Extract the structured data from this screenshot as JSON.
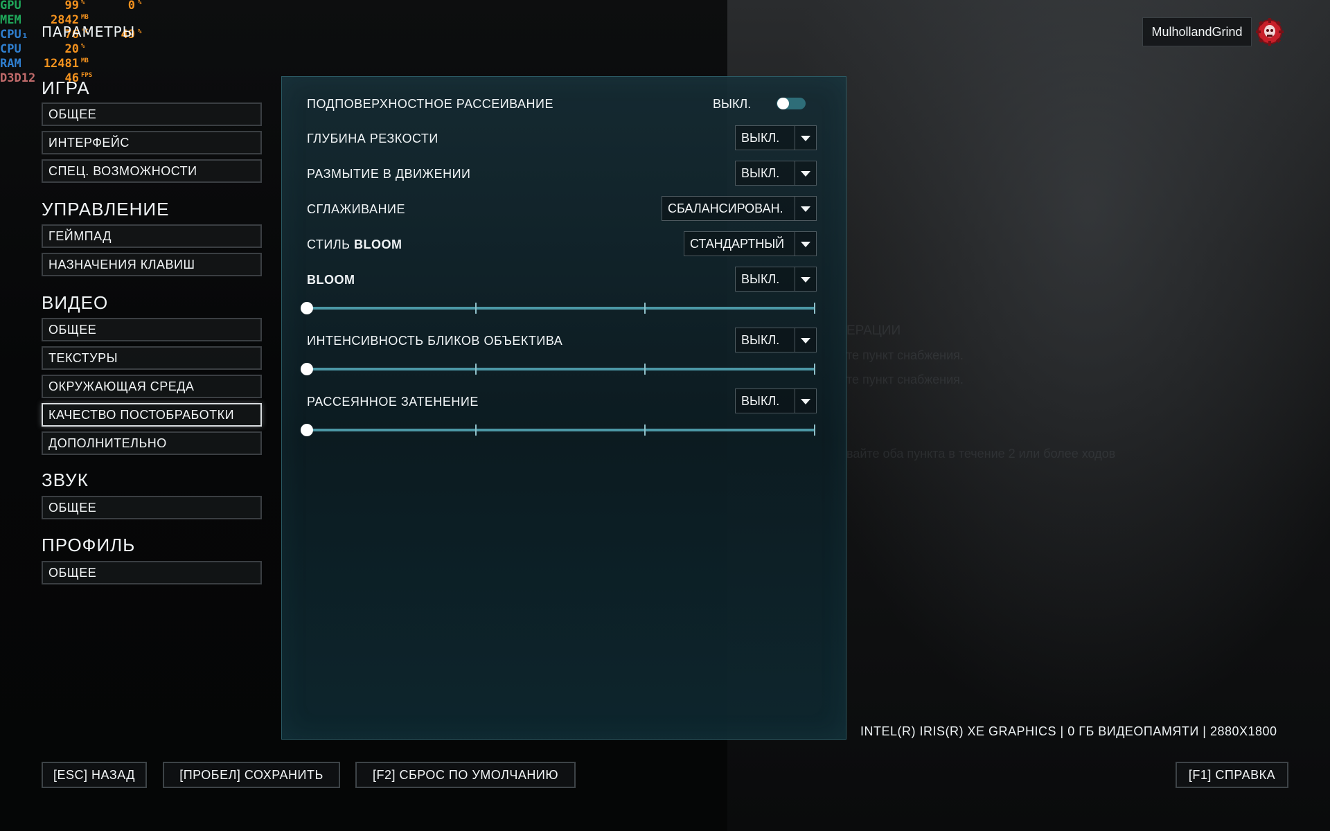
{
  "osd": {
    "rows": [
      {
        "label": "GPU",
        "label_color": "#1fa85a",
        "v1": "99",
        "u1": "%",
        "v2": "0",
        "u2": "%"
      },
      {
        "label": "MEM",
        "label_color": "#1fa85a",
        "v1": "2842",
        "u1": "MB",
        "v2": "",
        "u2": ""
      },
      {
        "label": "CPU₁",
        "label_color": "#2f7fd0",
        "v1": "76",
        "u1": "°C",
        "v2": "49",
        "u2": "%"
      },
      {
        "label": "CPU",
        "label_color": "#2f7fd0",
        "v1": "20",
        "u1": "%",
        "v2": "",
        "u2": ""
      },
      {
        "label": "RAM",
        "label_color": "#2f7fd0",
        "v1": "12481",
        "u1": "MB",
        "v2": "",
        "u2": ""
      },
      {
        "label": "D3D12",
        "label_color": "#c06a6a",
        "v1": "46",
        "u1": "FPS",
        "v2": "",
        "u2": ""
      }
    ]
  },
  "page_title": "ПАРАМЕТРЫ",
  "user": {
    "name": "MulhollandGrind",
    "avatar_icon": "gears-cog-skull-icon",
    "avatar_color": "#c8202a"
  },
  "sidebar": {
    "sections": [
      {
        "title": "ИГРА",
        "items": [
          "ОБЩЕЕ",
          "ИНТЕРФЕЙС",
          "СПЕЦ. ВОЗМОЖНОСТИ"
        ]
      },
      {
        "title": "УПРАВЛЕНИЕ",
        "items": [
          "ГЕЙМПАД",
          "НАЗНАЧЕНИЯ КЛАВИШ"
        ]
      },
      {
        "title": "ВИДЕО",
        "items": [
          "ОБЩЕЕ",
          "ТЕКСТУРЫ",
          "ОКРУЖАЮЩАЯ СРЕДА",
          "КАЧЕСТВО ПОСТОБРАБОТКИ",
          "ДОПОЛНИТЕЛЬНО"
        ]
      },
      {
        "title": "ЗВУК",
        "items": [
          "ОБЩЕЕ"
        ]
      },
      {
        "title": "ПРОФИЛЬ",
        "items": [
          "ОБЩЕЕ"
        ]
      }
    ],
    "active": "КАЧЕСТВО ПОСТОБРАБОТКИ"
  },
  "settings": {
    "subsurface": {
      "label": "ПОДПОВЕРХНОСТНОЕ РАССЕИВАНИЕ",
      "state_text": "ВЫКЛ.",
      "on": false
    },
    "dof": {
      "label": "ГЛУБИНА РЕЗКОСТИ",
      "value": "ВЫКЛ."
    },
    "motion_blur": {
      "label": "РАЗМЫТИЕ В ДВИЖЕНИИ",
      "value": "ВЫКЛ."
    },
    "aa": {
      "label": "СГЛАЖИВАНИЕ",
      "value": "СБАЛАНСИРОВАН."
    },
    "bloom_style": {
      "label_prefix": "СТИЛЬ ",
      "label_bold": "BLOOM",
      "value": "СТАНДАРТНЫЙ"
    },
    "bloom": {
      "label_bold": "BLOOM",
      "value": "ВЫКЛ.",
      "slider": 0
    },
    "lens_flare": {
      "label": "ИНТЕНСИВНОСТЬ БЛИКОВ ОБЪЕКТИВА",
      "value": "ВЫКЛ.",
      "slider": 0
    },
    "ao": {
      "label": "РАССЕЯННОЕ ЗАТЕНЕНИЕ",
      "value": "ВЫКЛ.",
      "slider": 0
    }
  },
  "gpu_info": "INTEL(R) IRIS(R) XE GRAPHICS | 0 ГБ ВИДЕОПАМЯТИ | 2880X1800",
  "footer": {
    "back": "[ESC] НАЗАД",
    "save": "[ПРОБЕЛ] СОХРАНИТЬ",
    "reset": "[F2] СБРОС ПО УМОЛЧАНИЮ",
    "help": "[F1] СПРАВКА"
  },
  "background_text": [
    "ЕРАЦИИ",
    "те пункт снабжения.",
    "те пункт снабжения.",
    "вайте оба пункта в течение 2 или более ходов"
  ]
}
